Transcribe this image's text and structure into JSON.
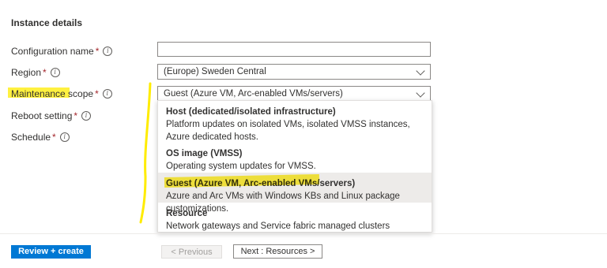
{
  "section": {
    "title": "Instance details"
  },
  "fields": {
    "configuration_name": {
      "label": "Configuration name",
      "required": "*",
      "value": ""
    },
    "region": {
      "label": "Region",
      "required": "*",
      "value": "(Europe) Sweden Central"
    },
    "maintenance_scope": {
      "label": "Maintenance scope",
      "required": "*",
      "value": "Guest (Azure VM, Arc-enabled VMs/servers)"
    },
    "reboot_setting": {
      "label": "Reboot setting",
      "required": "*"
    },
    "schedule": {
      "label": "Schedule",
      "required": "*"
    }
  },
  "dropdown": {
    "options": [
      {
        "title": "Host (dedicated/isolated infrastructure)",
        "description": "Platform updates on isolated VMs, isolated VMSS instances, Azure dedicated hosts."
      },
      {
        "title": "OS image (VMSS)",
        "description": "Operating system updates for VMSS."
      },
      {
        "title": "Guest (Azure VM, Arc-enabled VMs/servers)",
        "description": "Azure and Arc VMs with Windows KBs and Linux package customizations."
      },
      {
        "title": "Resource",
        "description": "Network gateways and Service fabric managed clusters"
      }
    ],
    "selected_index": 2
  },
  "footer": {
    "review_create": "Review + create",
    "previous": "< Previous",
    "next": "Next : Resources >"
  },
  "icons": {
    "info": "info-icon",
    "chevron": "chevron-down-icon"
  },
  "colors": {
    "primary": "#0078d4",
    "required": "#a4262c",
    "highlight": "#ffec00",
    "selected_option": "#edebe9"
  }
}
